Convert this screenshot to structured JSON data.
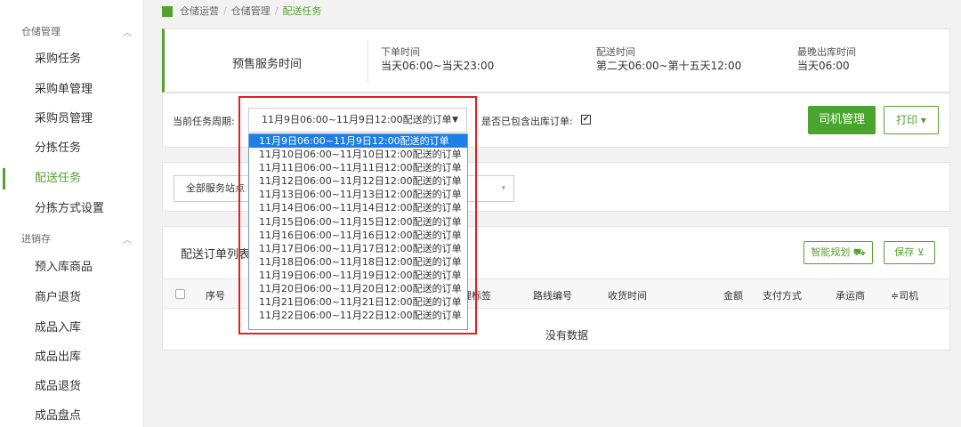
{
  "sidebar": {
    "groups": [
      {
        "label": "仓储管理",
        "chevron": "︿"
      },
      {
        "label": "进销存",
        "chevron": "︿"
      }
    ],
    "warehouse_items": [
      "采购任务",
      "采购单管理",
      "采购员管理",
      "分拣任务",
      "配送任务",
      "分拣方式设置"
    ],
    "inventory_items": [
      "预入库商品",
      "商户退货",
      "成品入库",
      "成品出库",
      "成品退货",
      "成品盘点"
    ],
    "active_color": "#56a030"
  },
  "breadcrumb": {
    "items": [
      "仓储运营",
      "仓储管理",
      "配送任务"
    ],
    "separator": "/"
  },
  "info": {
    "title": "预售服务时间",
    "order_time_label": "下单时间",
    "order_time_value": "当天06:00~当天23:00",
    "delivery_time_label": "配送时间",
    "delivery_time_value": "第二天06:00~第十五天12:00",
    "latest_out_label": "最晚出库时间",
    "latest_out_value": "当天06:00"
  },
  "filter": {
    "period_label": "当前任务周期:",
    "period_selected": "11月9日06:00~11月9日12:00配送的订单",
    "period_caret": "▼",
    "include_label": "是否已包含出库订单:",
    "include_checked": "✔",
    "driver_button": "司机管理",
    "print_button": "打印 ▾"
  },
  "station": {
    "placeholder": "全部服务站点",
    "caret": "▾"
  },
  "orders": {
    "title": "配送订单列表",
    "smart_plan_button": "智能规划 ⛟",
    "save_button": "保存 ⊻",
    "columns": [
      "序号",
      "理标签",
      "路线编号",
      "收货时间",
      "金额",
      "支付方式",
      "承运商",
      "≑司机"
    ],
    "empty_text": "没有数据"
  },
  "dropdown": {
    "options": [
      "11月9日06:00~11月9日12:00配送的订单",
      "11月10日06:00~11月10日12:00配送的订单",
      "11月11日06:00~11月11日12:00配送的订单",
      "11月12日06:00~11月12日12:00配送的订单",
      "11月13日06:00~11月13日12:00配送的订单",
      "11月14日06:00~11月14日12:00配送的订单",
      "11月15日06:00~11月15日12:00配送的订单",
      "11月16日06:00~11月16日12:00配送的订单",
      "11月17日06:00~11月17日12:00配送的订单",
      "11月18日06:00~11月18日12:00配送的订单",
      "11月19日06:00~11月19日12:00配送的订单",
      "11月20日06:00~11月20日12:00配送的订单",
      "11月21日06:00~11月21日12:00配送的订单",
      "11月22日06:00~11月22日12:00配送的订单"
    ],
    "selected_index": 0
  }
}
